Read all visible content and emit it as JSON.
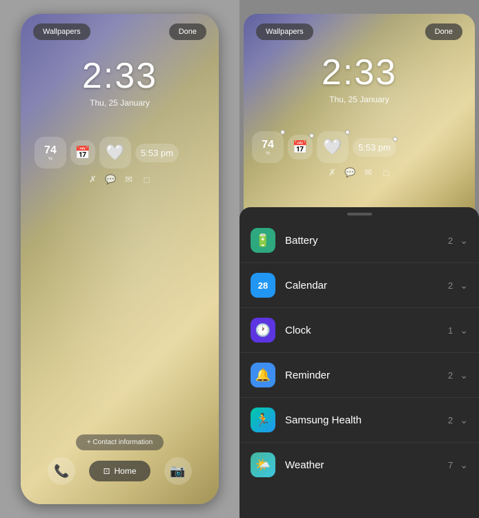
{
  "left": {
    "wallpapers_btn": "Wallpapers",
    "done_btn": "Done",
    "clock_time": "2:33",
    "clock_date": "Thu, 25 January",
    "battery_num": "74",
    "widget_time": "5:53 pm",
    "contact_btn": "+ Contact information",
    "home_btn": "Home"
  },
  "right": {
    "wallpapers_btn": "Wallpapers",
    "done_btn": "Done",
    "clock_time": "2:33",
    "clock_date": "Thu, 25 January",
    "battery_num": "74",
    "widget_time": "5:53 pm",
    "list_items": [
      {
        "id": "battery",
        "label": "Battery",
        "count": "2",
        "icon_color": "icon-battery",
        "icon": "🔋"
      },
      {
        "id": "calendar",
        "label": "Calendar",
        "count": "2",
        "icon_color": "icon-calendar",
        "icon": "📅"
      },
      {
        "id": "clock",
        "label": "Clock",
        "count": "1",
        "icon_color": "icon-clock",
        "icon": "🕐"
      },
      {
        "id": "reminder",
        "label": "Reminder",
        "count": "2",
        "icon_color": "icon-reminder",
        "icon": "🔔"
      },
      {
        "id": "samsung-health",
        "label": "Samsung Health",
        "count": "2",
        "icon_color": "icon-samsung-health",
        "icon": "🏃"
      },
      {
        "id": "weather",
        "label": "Weather",
        "count": "7",
        "icon_color": "icon-weather",
        "icon": "🌤️"
      }
    ]
  }
}
